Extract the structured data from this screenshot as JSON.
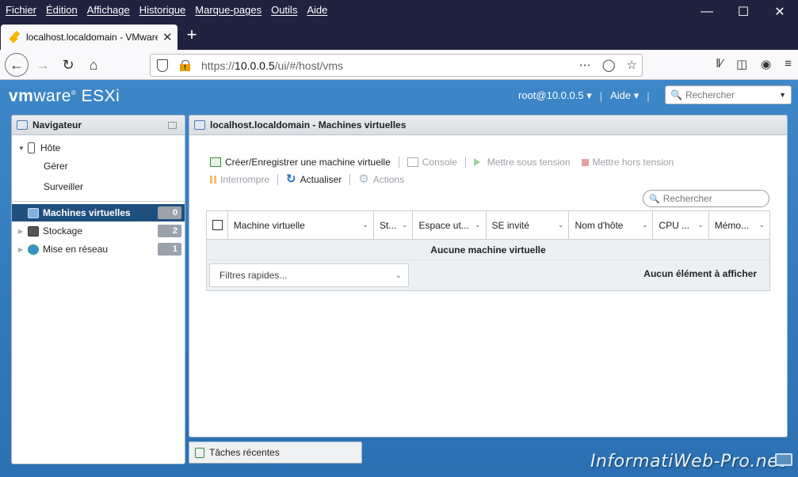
{
  "firefox": {
    "menu": [
      "Fichier",
      "Édition",
      "Affichage",
      "Historique",
      "Marque-pages",
      "Outils",
      "Aide"
    ],
    "tab_title": "localhost.localdomain - VMware",
    "url_prefix": "https://",
    "url_host": "10.0.0.5",
    "url_path": "/ui/#/host/vms"
  },
  "esxi": {
    "logo_vm": "vm",
    "logo_rest": "ware",
    "logo_product": "ESXi",
    "user": "root@10.0.0.5",
    "help": "Aide",
    "search_placeholder": "Rechercher"
  },
  "navigator": {
    "title": "Navigateur",
    "host": "Hôte",
    "host_children": [
      "Gérer",
      "Surveiller"
    ],
    "items": [
      {
        "label": "Machines virtuelles",
        "count": "0"
      },
      {
        "label": "Stockage",
        "count": "2"
      },
      {
        "label": "Mise en réseau",
        "count": "1"
      }
    ]
  },
  "main": {
    "title": "localhost.localdomain - Machines virtuelles",
    "toolbar": {
      "create": "Créer/Enregistrer une machine virtuelle",
      "console": "Console",
      "power_on": "Mettre sous tension",
      "power_off": "Mettre hors tension",
      "suspend": "Interrompre",
      "refresh": "Actualiser",
      "actions": "Actions"
    },
    "search_placeholder": "Rechercher",
    "columns": [
      "Machine virtuelle",
      "St...",
      "Espace ut...",
      "SE invité",
      "Nom d'hôte",
      "CPU ...",
      "Mémo..."
    ],
    "empty_text": "Aucune machine virtuelle",
    "quick_filter": "Filtres rapides...",
    "count_text": "Aucun élément à afficher"
  },
  "tasks": {
    "label": "Tâches récentes"
  },
  "watermark": "InformatiWeb-Pro.net"
}
